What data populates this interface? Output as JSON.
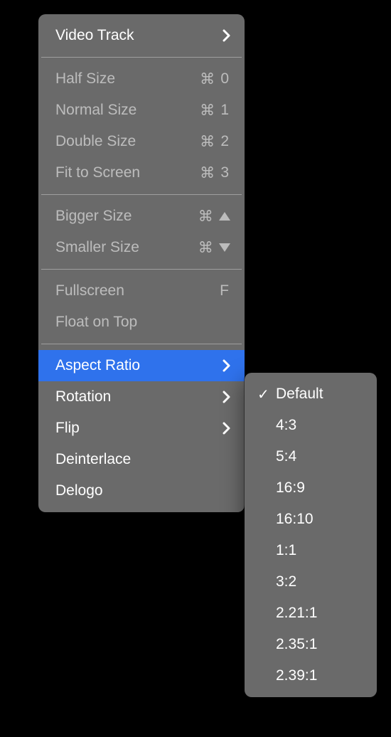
{
  "mainMenu": {
    "groups": [
      [
        {
          "id": "video-track",
          "label": "Video Track",
          "submenu": true,
          "bright": true
        }
      ],
      [
        {
          "id": "half-size",
          "label": "Half Size",
          "shortcut_cmd": true,
          "shortcut_key": "0"
        },
        {
          "id": "normal-size",
          "label": "Normal Size",
          "shortcut_cmd": true,
          "shortcut_key": "1"
        },
        {
          "id": "double-size",
          "label": "Double Size",
          "shortcut_cmd": true,
          "shortcut_key": "2"
        },
        {
          "id": "fit-screen",
          "label": "Fit to Screen",
          "shortcut_cmd": true,
          "shortcut_key": "3"
        }
      ],
      [
        {
          "id": "bigger-size",
          "label": "Bigger Size",
          "shortcut_cmd": true,
          "shortcut_tri": "up"
        },
        {
          "id": "smaller-size",
          "label": "Smaller Size",
          "shortcut_cmd": true,
          "shortcut_tri": "down"
        }
      ],
      [
        {
          "id": "fullscreen",
          "label": "Fullscreen",
          "shortcut_key": "F"
        },
        {
          "id": "float-on-top",
          "label": "Float on Top"
        }
      ],
      [
        {
          "id": "aspect-ratio",
          "label": "Aspect Ratio",
          "submenu": true,
          "highlight": true,
          "bright": true
        },
        {
          "id": "rotation",
          "label": "Rotation",
          "submenu": true,
          "bright": true
        },
        {
          "id": "flip",
          "label": "Flip",
          "submenu": true,
          "bright": true
        },
        {
          "id": "deinterlace",
          "label": "Deinterlace",
          "bright": true
        },
        {
          "id": "delogo",
          "label": "Delogo",
          "bright": true
        }
      ]
    ]
  },
  "subMenu": {
    "items": [
      {
        "id": "ar-default",
        "label": "Default",
        "checked": true
      },
      {
        "id": "ar-4-3",
        "label": "4:3"
      },
      {
        "id": "ar-5-4",
        "label": "5:4"
      },
      {
        "id": "ar-16-9",
        "label": "16:9"
      },
      {
        "id": "ar-16-10",
        "label": "16:10"
      },
      {
        "id": "ar-1-1",
        "label": "1:1"
      },
      {
        "id": "ar-3-2",
        "label": "3:2"
      },
      {
        "id": "ar-221-1",
        "label": "2.21:1"
      },
      {
        "id": "ar-235-1",
        "label": "2.35:1"
      },
      {
        "id": "ar-239-1",
        "label": "2.39:1"
      }
    ]
  },
  "glyphs": {
    "cmd": "⌘",
    "check": "✓"
  }
}
